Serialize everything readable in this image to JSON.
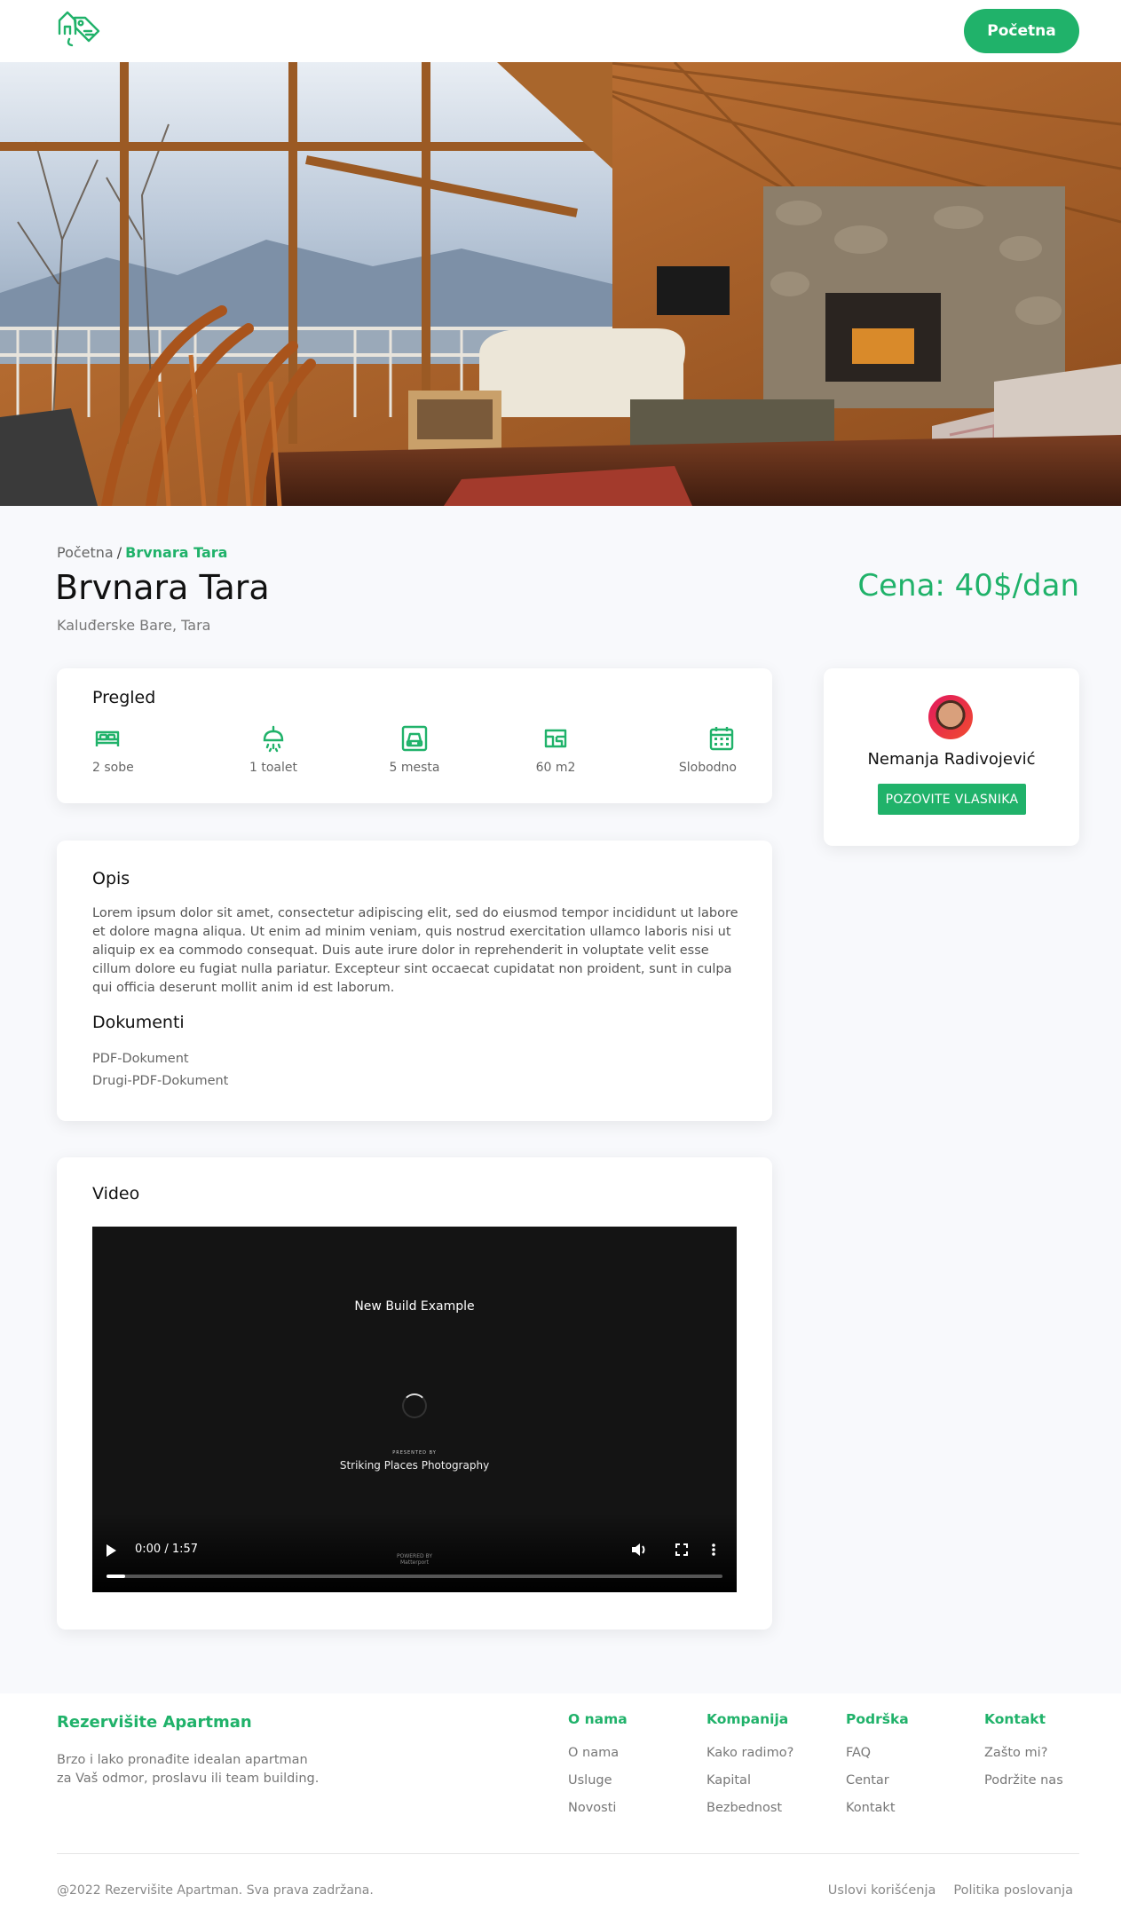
{
  "header": {
    "home_button": "Početna"
  },
  "breadcrumb": {
    "home": "Početna",
    "separator": "/",
    "current": "Brvnara Tara"
  },
  "listing": {
    "title": "Brvnara Tara",
    "location": "Kaluđerske Bare, Tara",
    "price": "Cena: 40$/dan"
  },
  "overview": {
    "heading": "Pregled",
    "items": [
      {
        "icon": "bed-icon",
        "label": "2 sobe"
      },
      {
        "icon": "shower-icon",
        "label": "1 toalet"
      },
      {
        "icon": "car-icon",
        "label": "5 mesta"
      },
      {
        "icon": "floorplan-icon",
        "label": "60 m2"
      },
      {
        "icon": "calendar-icon",
        "label": "Slobodno"
      }
    ]
  },
  "description": {
    "heading": "Opis",
    "text": "Lorem ipsum dolor sit amet, consectetur adipiscing elit, sed do eiusmod tempor incididunt ut labore et dolore magna aliqua. Ut enim ad minim veniam, quis nostrud exercitation ullamco laboris nisi ut aliquip ex ea commodo consequat. Duis aute irure dolor in reprehenderit in voluptate velit esse cillum dolore eu fugiat nulla pariatur. Excepteur sint occaecat cupidatat non proident, sunt in culpa qui officia deserunt mollit anim id est laborum."
  },
  "documents": {
    "heading": "Dokumenti",
    "items": [
      "PDF-Dokument",
      "Drugi-PDF-Dokument"
    ]
  },
  "video": {
    "heading": "Video",
    "title": "New Build Example",
    "spinner_text": "LOADING",
    "presented_by": "PRESENTED BY",
    "author": "Striking Places Photography",
    "time": "0:00 / 1:57",
    "powered_by": "POWERED BY",
    "brand": "Matterport",
    "progress": 0.03
  },
  "owner": {
    "name": "Nemanja Radivojević",
    "call_button": "POZOVITE VLASNIKA"
  },
  "footer": {
    "brand": "Rezervišite Apartman",
    "tagline_line1": "Brzo i lako pronađite idealan apartman",
    "tagline_line2": "za Vaš odmor, proslavu ili team building.",
    "columns": [
      {
        "title": "O nama",
        "links": [
          "O nama",
          "Usluge",
          "Novosti"
        ]
      },
      {
        "title": "Kompanija",
        "links": [
          "Kako radimo?",
          "Kapital",
          "Bezbednost"
        ]
      },
      {
        "title": "Podrška",
        "links": [
          "FAQ",
          "Centar",
          "Kontakt"
        ]
      },
      {
        "title": "Kontakt",
        "links": [
          "Zašto mi?",
          "Podržite nas"
        ]
      }
    ],
    "copyright": "@2022 Rezervišite Apartman. Sva prava zadržana.",
    "legal": [
      "Uslovi korišćenja",
      "Politika poslovanja"
    ]
  },
  "colors": {
    "accent": "#20b26a",
    "background": "#f8f9fc",
    "card": "#ffffff",
    "video_bg": "#141414"
  }
}
